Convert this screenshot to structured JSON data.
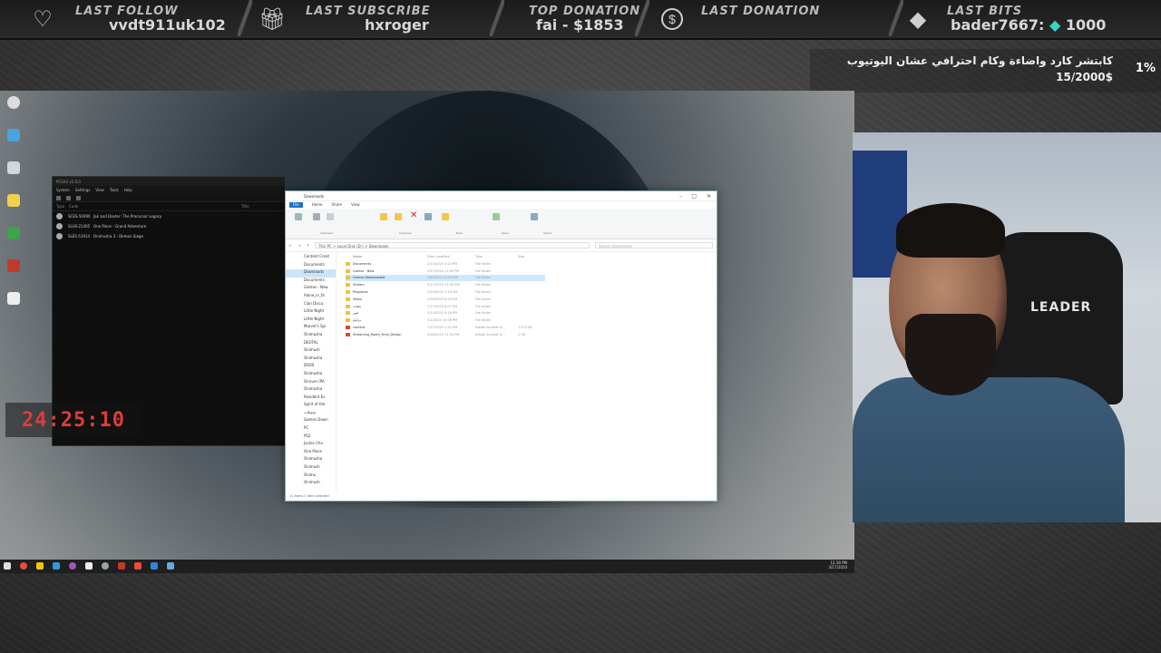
{
  "alerts": {
    "last_follow_label": "LAST FOLLOW",
    "last_follow_value": "vvdt911uk102",
    "last_subscribe_label": "LAST SUBSCRIBE",
    "last_subscribe_value": "hxroger",
    "top_donation_label": "TOP DONATION",
    "top_donation_value": "fai - $1853",
    "last_donation_label": "LAST DONATION",
    "last_bits_label": "LAST BITS",
    "last_bits_user": "bader7667:",
    "last_bits_amount": "1000",
    "icons": [
      "heart-icon",
      "gift-icon",
      "dollar-coin-icon",
      "bits-gem-icon"
    ]
  },
  "goal": {
    "text": "كابتشر كارد واضاءة وكام احترافي عشان اليوتيوب",
    "amount": "15/2000$",
    "percent": "1%",
    "progress": 0.01
  },
  "timer": "24:25:10",
  "emulator": {
    "title": "PCSX2 v1.6.0",
    "menu": [
      "System",
      "Settings",
      "View",
      "Tools",
      "Help"
    ],
    "columns": [
      "Type",
      "Code",
      "Title"
    ],
    "games": [
      {
        "code": "SCES-50490",
        "title": "Jak and Daxter: The Precursor Legacy"
      },
      {
        "code": "SLUS-21405",
        "title": "One Piece - Grand Adventure"
      },
      {
        "code": "SLES-51914",
        "title": "Onimusha 3 - Demon Siege"
      }
    ]
  },
  "explorer": {
    "title": "Downloads",
    "tabs": [
      "File",
      "Home",
      "Share",
      "View"
    ],
    "ribbon_groups": [
      "Clipboard",
      "Organize",
      "New",
      "Open",
      "Select"
    ],
    "path": "This PC > Local Disk (D:) > Downloads",
    "search_placeholder": "Search Downloads",
    "columns": [
      "Name",
      "Date modified",
      "Type",
      "Size"
    ],
    "nav": [
      "Content Creat",
      "Documents",
      "Downloads",
      "Documents",
      "Games - New",
      "Alone_in_th",
      "Clan Discu",
      "Little Night",
      "Little Night",
      "Marvel's Spi",
      "Onimusha",
      "DIGITAL",
      "Onimush",
      "Onimusha",
      "DSOS",
      "Onimusha",
      "Onirum (PA",
      "Onimusha",
      "Resident Ev",
      "Spirit of the",
      "تحميلات",
      "Games Down",
      "PC",
      "PS2",
      "Jackie Cha",
      "One Piece",
      "Onimusha",
      "Onimush",
      "Onimu",
      "Onimush"
    ],
    "files": [
      {
        "name": "Documents",
        "date": "2/14/2020 4:24 PM",
        "type": "File folder",
        "size": ""
      },
      {
        "name": "Games - New",
        "date": "3/17/2020 11:09 PM",
        "type": "File folder",
        "size": ""
      },
      {
        "name": "Games Downloaded",
        "date": "3/8/2020 12:09 AM",
        "type": "File folder",
        "size": ""
      },
      {
        "name": "Stream",
        "date": "3/17/2020 11:16 AM",
        "type": "File folder",
        "size": ""
      },
      {
        "name": "Programs",
        "date": "3/20/2020 2:16 AM",
        "type": "File folder",
        "size": ""
      },
      {
        "name": "Video",
        "date": "3/16/2020 8:54 PM",
        "type": "File folder",
        "size": ""
      },
      {
        "name": "ملفات",
        "date": "7/17/2020 8:07 PM",
        "type": "File folder",
        "size": ""
      },
      {
        "name": "صور",
        "date": "3/23/2020 4:16 PM",
        "type": "File folder",
        "size": ""
      },
      {
        "name": "برنامج",
        "date": "3/1/2020 10:08 PM",
        "type": "File folder",
        "size": ""
      },
      {
        "name": "content",
        "date": "7/27/2020 1:22 PM",
        "type": "Adobe Acrobat D...",
        "size": "1,074 KB"
      },
      {
        "name": "Streaming_Room_Final_Design",
        "date": "3/28/2020 11:54 PM",
        "type": "Adobe Acrobat D...",
        "size": "1 KB"
      }
    ],
    "status": "11 items   1 item selected"
  },
  "taskbar": {
    "time": "12:18 PM",
    "date": "3/17/2020"
  },
  "webcam": {
    "chair_text": "LEADER"
  }
}
